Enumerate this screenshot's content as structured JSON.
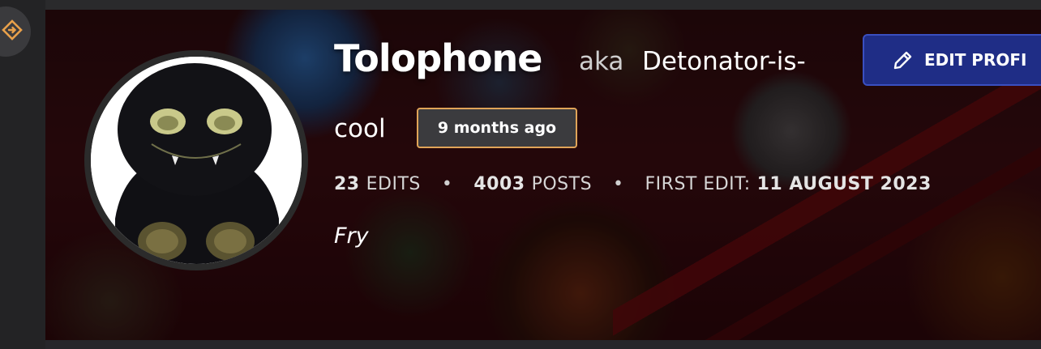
{
  "profile": {
    "username": "Tolophone",
    "aka_label": "aka",
    "alias_line1": "Detonator-is-",
    "alias_line2": "cool",
    "last_active": "9 months ago",
    "edits_count": "23",
    "edits_label": "EDITS",
    "posts_count": "4003",
    "posts_label": "POSTS",
    "first_edit_label": "FIRST EDIT:",
    "first_edit_date": "11 AUGUST 2023",
    "separator": "•",
    "tagline": "Fry"
  },
  "actions": {
    "edit_profile_label": "EDIT PROFI"
  },
  "icons": {
    "rail": "diamond-arrow-icon",
    "edit": "pencil-icon"
  },
  "colors": {
    "badge_border": "#e0a458",
    "edit_button_bg": "#1f2d86",
    "rail_icon": "#e8a04a"
  }
}
